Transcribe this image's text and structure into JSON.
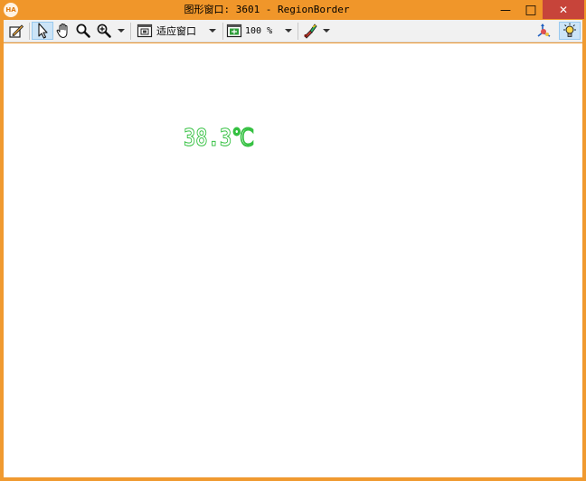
{
  "window": {
    "title": "图形窗口: 3601 - RegionBorder",
    "app_icon_text": "HA",
    "minimize_symbol": "—",
    "maximize_symbol": "□",
    "close_symbol": "✕"
  },
  "toolbar": {
    "zoom_mode_label": "适应窗口",
    "zoom_percent_label": "100 %"
  },
  "canvas": {
    "text_region": "38.3℃",
    "region_color": "#33c040"
  },
  "icons": [
    "edit-graphics-icon",
    "pointer-icon",
    "pan-hand-icon",
    "magnifier-icon",
    "zoom-in-icon",
    "fit-window-icon",
    "zoom-percent-icon",
    "paint-icon",
    "axes-3d-icon",
    "light-bulb-icon"
  ]
}
